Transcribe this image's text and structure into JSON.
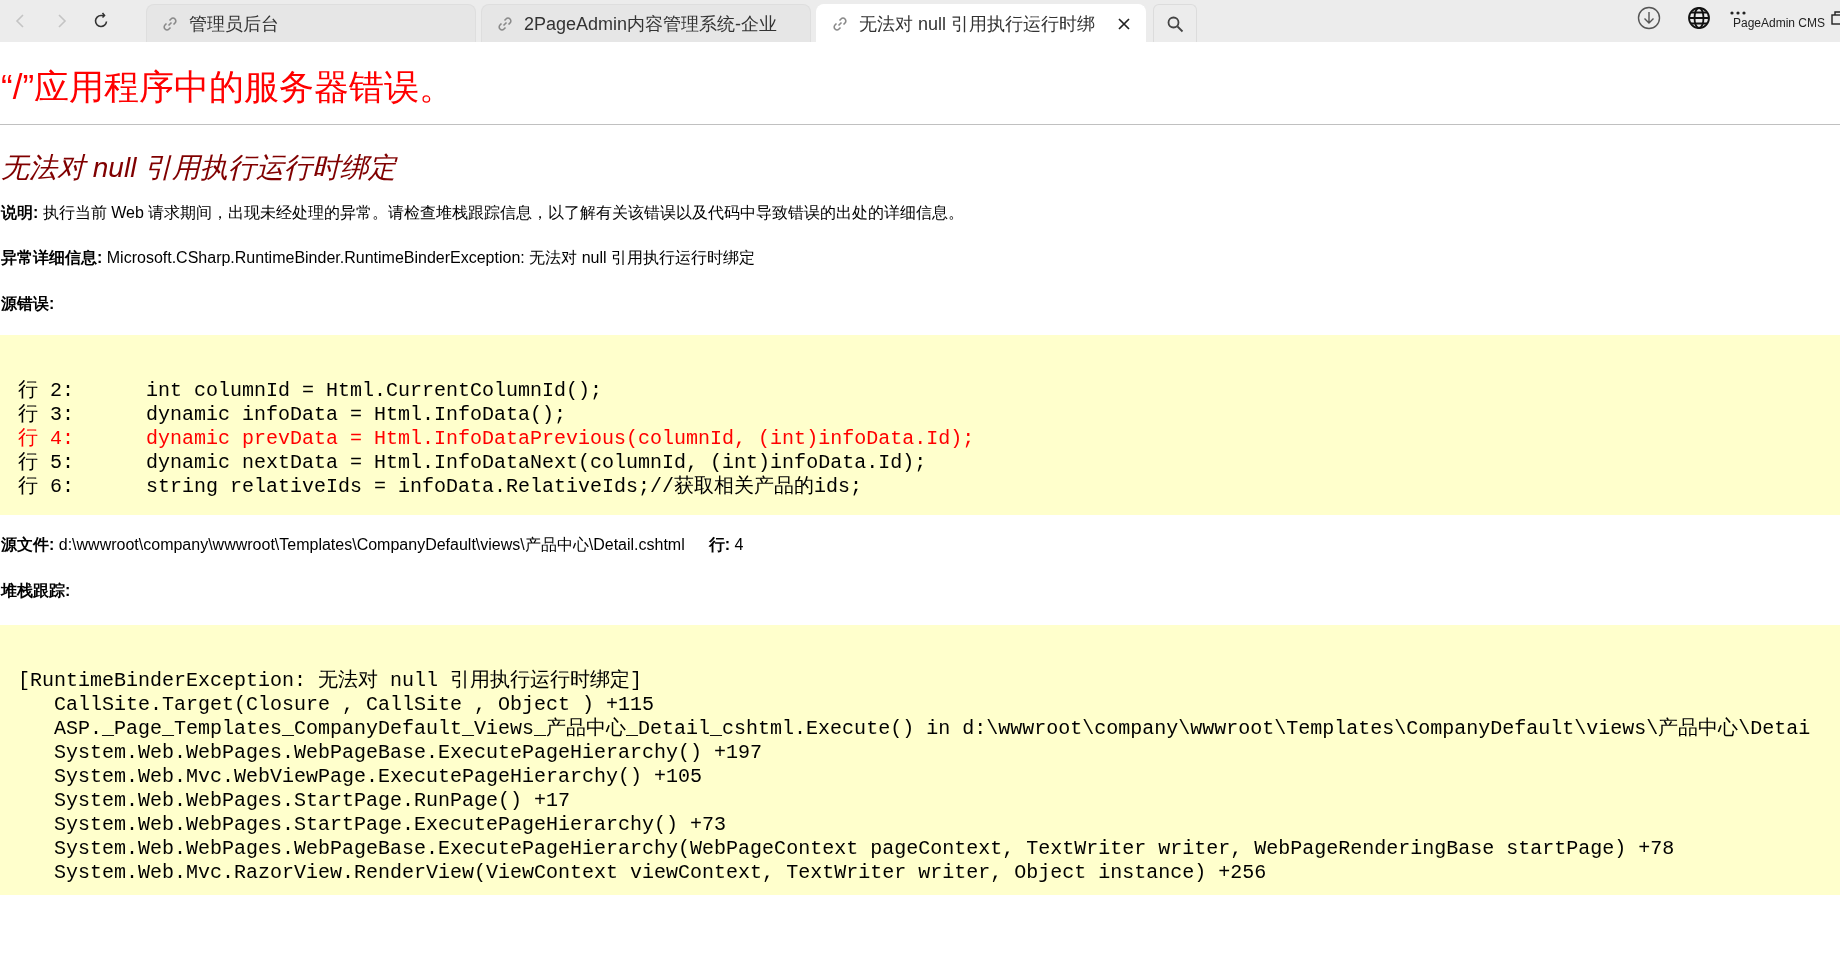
{
  "browser": {
    "tabs": [
      {
        "title": "管理员后台",
        "selected": false
      },
      {
        "title": "2PageAdmin内容管理系统-企业",
        "selected": false
      },
      {
        "title": "无法对 null 引用执行运行时绑",
        "selected": true
      }
    ],
    "profile_label": "PageAdmin CMS"
  },
  "page": {
    "title": "“/”应用程序中的服务器错误。",
    "error_title": "无法对 null 引用执行运行时绑定",
    "description": "**说明:** 执行当前 Web 请求期间，出现未经处理的异常。请检查堆栈跟踪信息，以了解有关该错误以及代码中导致错误的出处的详细信息。",
    "exception_details": "**异常详细信息:** Microsoft.CSharp.RuntimeBinder.RuntimeBinderException: 无法对 null 引用执行运行时绑定",
    "source_error_label": "源错误:",
    "source_lines": [
      {
        "text": "行 2:      int columnId = Html.CurrentColumnId();",
        "highlighted": false
      },
      {
        "text": "行 3:      dynamic infoData = Html.InfoData();",
        "highlighted": false
      },
      {
        "text": "行 4:      dynamic prevData = Html.InfoDataPrevious(columnId, (int)infoData.Id);",
        "highlighted": true
      },
      {
        "text": "行 5:      dynamic nextData = Html.InfoDataNext(columnId, (int)infoData.Id);",
        "highlighted": false
      },
      {
        "text": "行 6:      string relativeIds = infoData.RelativeIds;//获取相关产品的ids;",
        "highlighted": false
      }
    ],
    "source_file": "**源文件:** d:\\wwwroot\\company\\wwwroot\\Templates\\CompanyDefault\\views\\产品中心\\Detail.cshtml",
    "source_line": "**行:** 4",
    "stack_trace_label": "堆栈跟踪:",
    "stack_trace": [
      "[RuntimeBinderException: 无法对 null 引用执行运行时绑定]",
      "   CallSite.Target(Closure , CallSite , Object ) +115",
      "   ASP._Page_Templates_CompanyDefault_Views_产品中心_Detail_cshtml.Execute() in d:\\wwwroot\\company\\wwwroot\\Templates\\CompanyDefault\\views\\产品中心\\Detai",
      "   System.Web.WebPages.WebPageBase.ExecutePageHierarchy() +197",
      "   System.Web.Mvc.WebViewPage.ExecutePageHierarchy() +105",
      "   System.Web.WebPages.StartPage.RunPage() +17",
      "   System.Web.WebPages.StartPage.ExecutePageHierarchy() +73",
      "   System.Web.WebPages.WebPageBase.ExecutePageHierarchy(WebPageContext pageContext, TextWriter writer, WebPageRenderingBase startPage) +78",
      "   System.Web.Mvc.RazorView.RenderView(ViewContext viewContext, TextWriter writer, Object instance) +256"
    ]
  }
}
